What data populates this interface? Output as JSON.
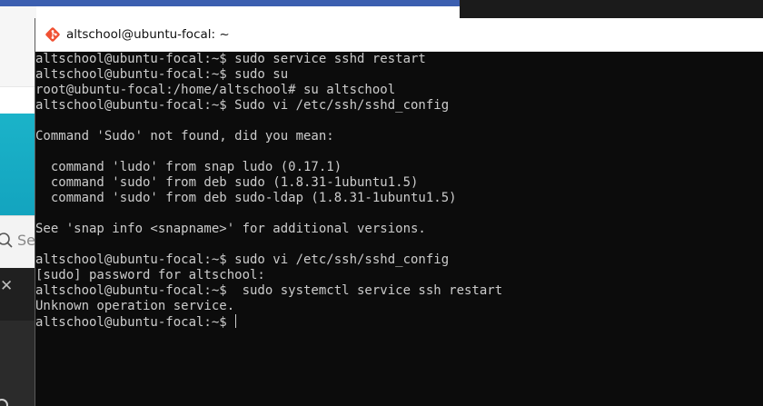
{
  "window": {
    "title": "altschool@ubuntu-focal: ~",
    "icon": "git-diamond-icon"
  },
  "background": {
    "search_partial": "Se"
  },
  "terminal": {
    "lines": [
      "altschool@ubuntu-focal:~$ sudo service sshd restart",
      "altschool@ubuntu-focal:~$ sudo su",
      "root@ubuntu-focal:/home/altschool# su altschool",
      "altschool@ubuntu-focal:~$ Sudo vi /etc/ssh/sshd_config",
      "",
      "Command 'Sudo' not found, did you mean:",
      "",
      "  command 'ludo' from snap ludo (0.17.1)",
      "  command 'sudo' from deb sudo (1.8.31-1ubuntu1.5)",
      "  command 'sudo' from deb sudo-ldap (1.8.31-1ubuntu1.5)",
      "",
      "See 'snap info <snapname>' for additional versions.",
      "",
      "altschool@ubuntu-focal:~$ sudo vi /etc/ssh/sshd_config",
      "[sudo] password for altschool:",
      "altschool@ubuntu-focal:~$  sudo systemctl service ssh restart",
      "Unknown operation service.",
      "altschool@ubuntu-focal:~$ "
    ]
  },
  "colors": {
    "terminal_bg": "#0c0c0c",
    "terminal_fg": "#cccccc",
    "icon_orange": "#f05133"
  }
}
